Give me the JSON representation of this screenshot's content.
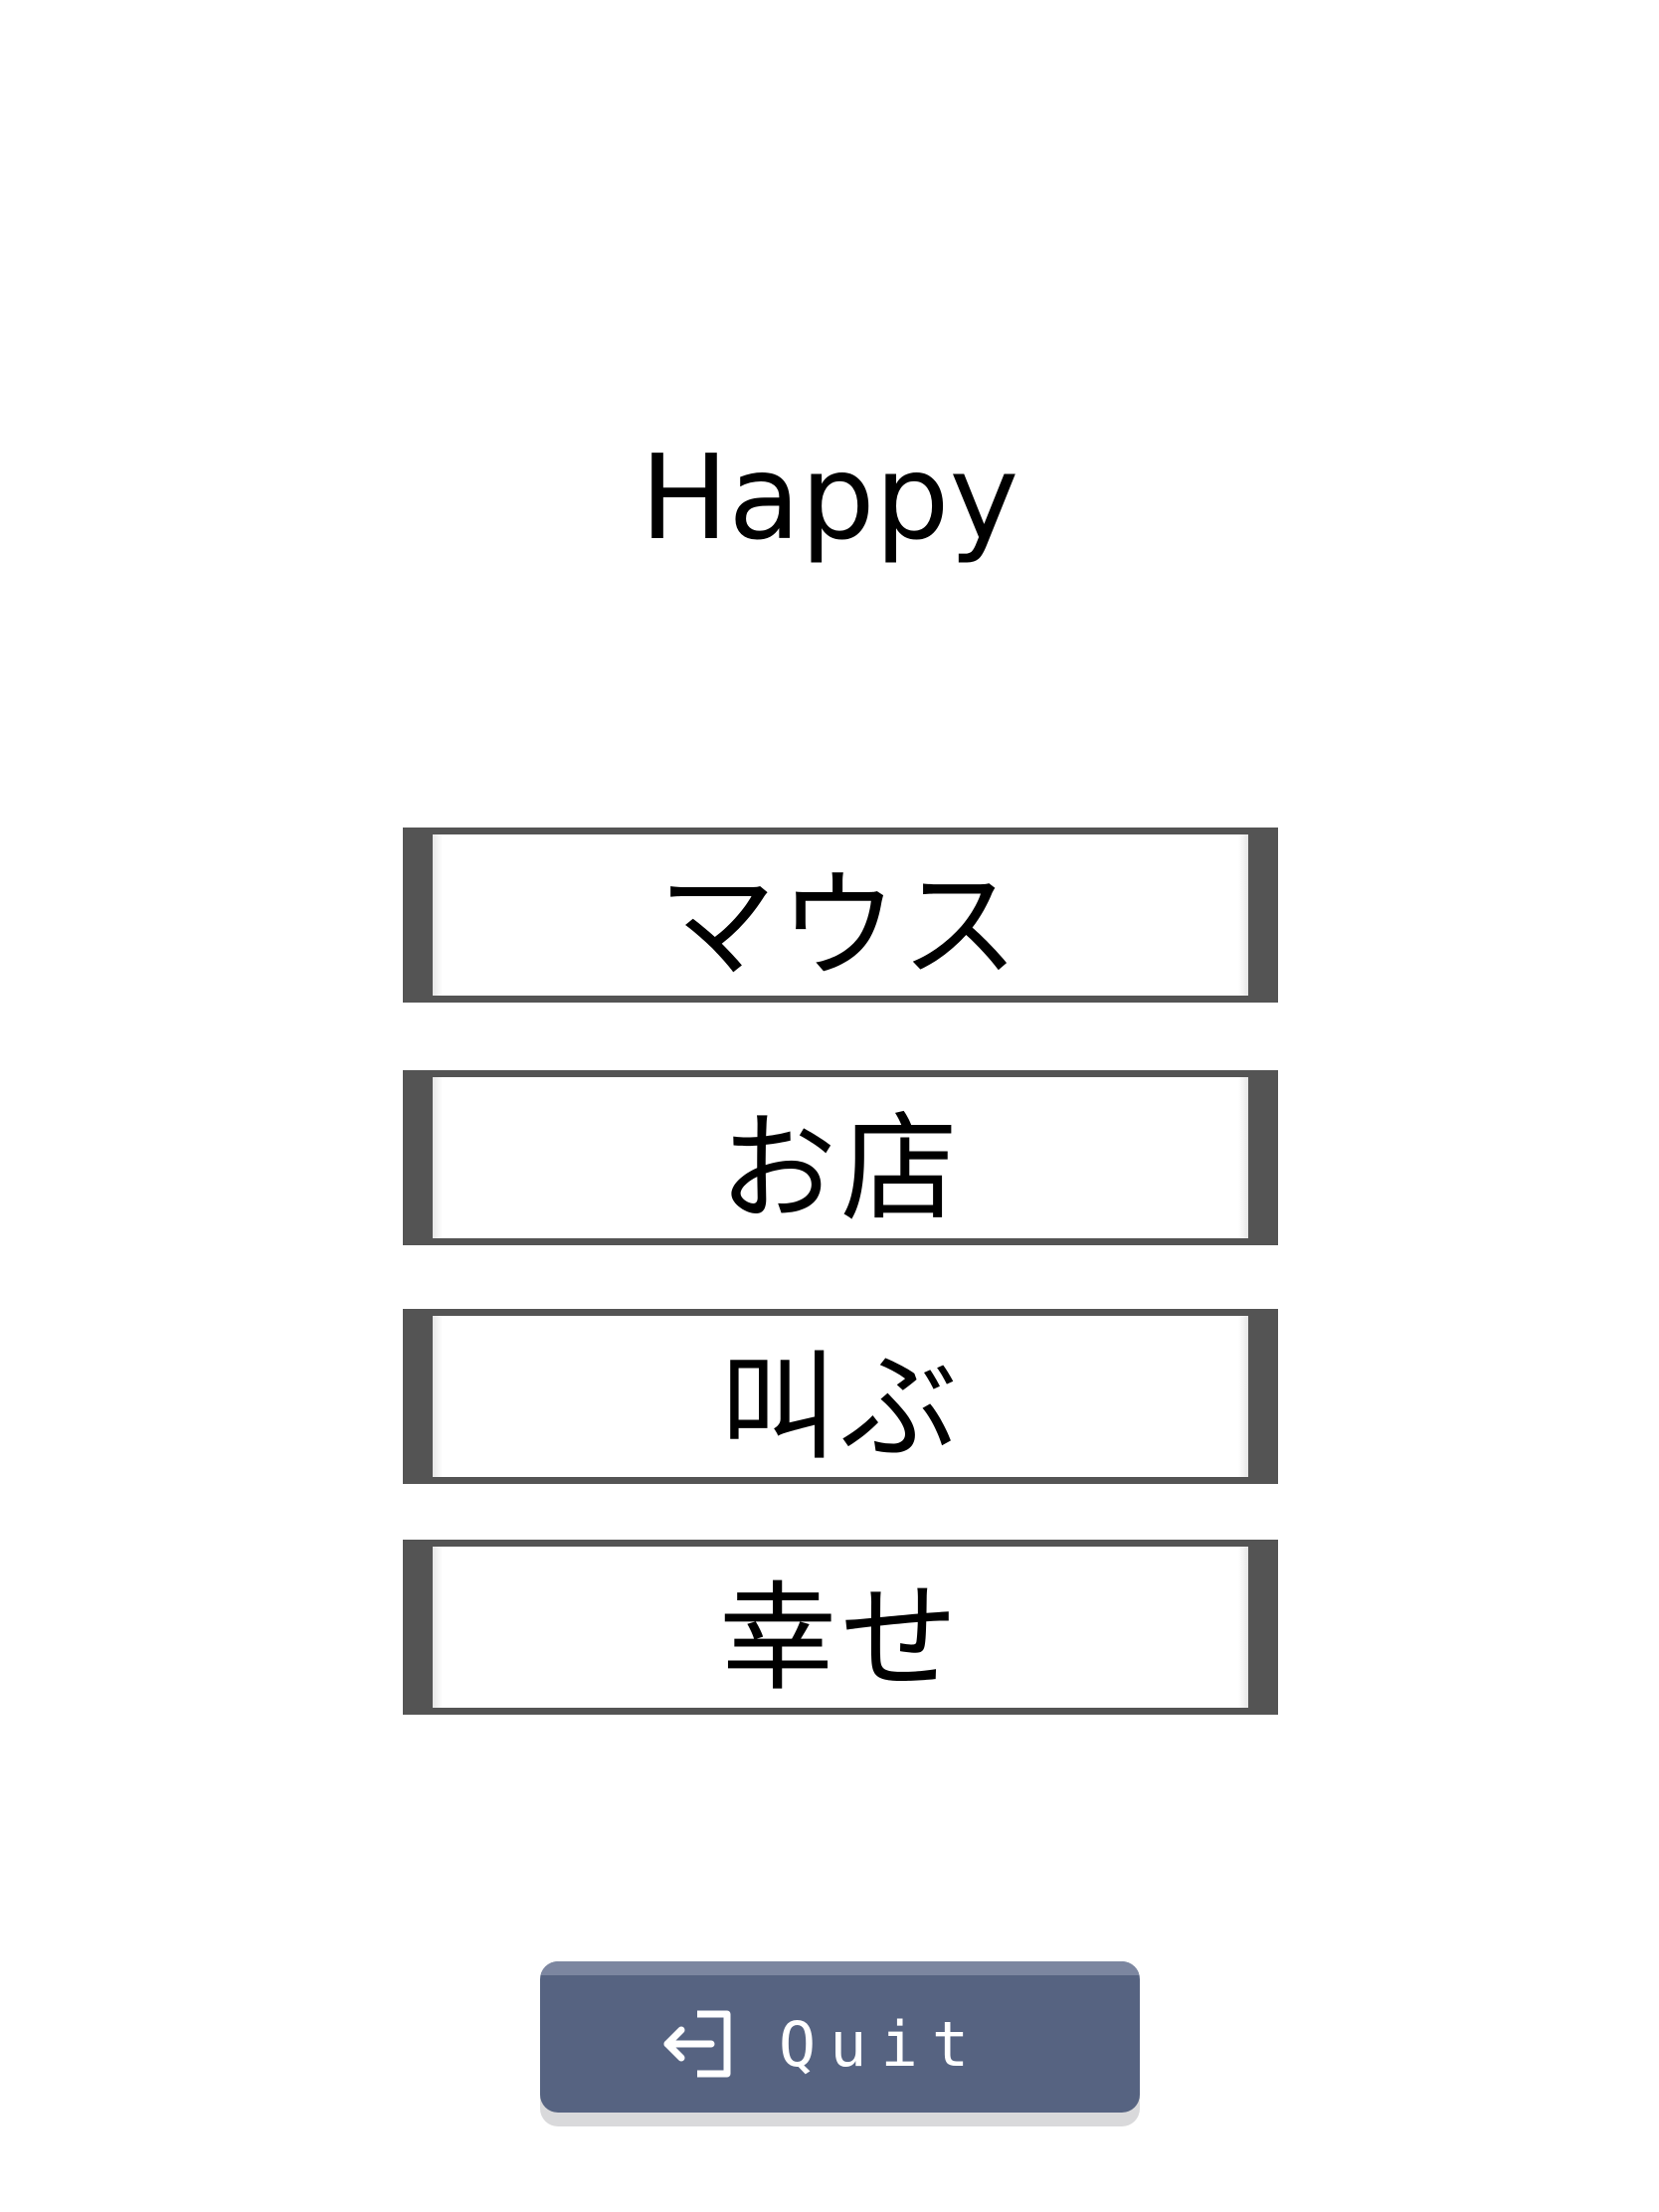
{
  "screen": {
    "title": "Happy"
  },
  "choices": [
    {
      "label": "マウス"
    },
    {
      "label": "お店"
    },
    {
      "label": "叫ぶ"
    },
    {
      "label": "幸せ"
    }
  ],
  "quit_button": {
    "label": "Quit",
    "icon": "exit-door-arrow-icon"
  },
  "colors": {
    "background": "#ffffff",
    "choice_frame": "#545454",
    "quit_button": "#566381",
    "text": "#000000"
  }
}
